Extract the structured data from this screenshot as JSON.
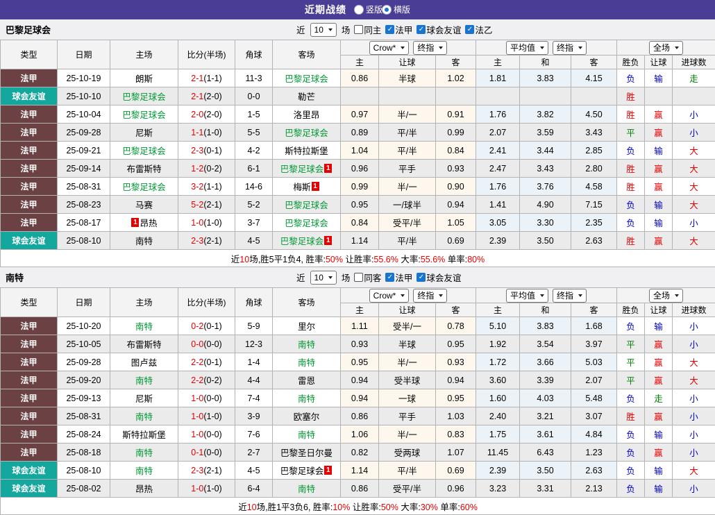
{
  "colors": {
    "titlebar_bg": "#4A3D96",
    "league": {
      "法甲": "#6B4143",
      "球会友谊": "#13A79E"
    },
    "focus_team_green": "#009933",
    "score_red": "#E60000",
    "checkbox_blue": "#1774D1",
    "even_row": "#EBEBEB",
    "crow_col_tint": "#FDF7EE",
    "avg_col_tint": "#ECF3F8",
    "result": {
      "胜": "#E60000",
      "赢": "#E60000",
      "大": "#E60000",
      "平": "#008000",
      "走": "#008000",
      "负": "#0000CC",
      "输": "#0000CC",
      "小": "#0000CC"
    }
  },
  "titlebar": {
    "title": "近期战绩",
    "radios": [
      {
        "label": "竖版",
        "checked": false
      },
      {
        "label": "横版",
        "checked": true
      }
    ]
  },
  "table_headers": {
    "main": [
      "类型",
      "日期",
      "主场",
      "比分(半场)",
      "角球",
      "客场"
    ],
    "selects": {
      "source": "Crow*",
      "source_ref": "终指",
      "avg": "平均值",
      "avg_ref": "终指",
      "scope": "全场"
    },
    "sub": [
      "主",
      "让球",
      "客",
      "主",
      "和",
      "客",
      "胜负",
      "让球",
      "进球数"
    ]
  },
  "sections": [
    {
      "team": "巴黎足球会",
      "filters": {
        "prefix": "近",
        "count": "10",
        "suffix": "场",
        "checks": [
          {
            "label": "同主",
            "checked": false
          },
          {
            "label": "法甲",
            "checked": true
          },
          {
            "label": "球会友谊",
            "checked": true
          },
          {
            "label": "法乙",
            "checked": true
          }
        ]
      },
      "rows": [
        {
          "league": "法甲",
          "date": "25-10-19",
          "home": {
            "name": "朗斯"
          },
          "score": "2-1",
          "half": "(1-1)",
          "corner": "11-3",
          "away": {
            "name": "巴黎足球会",
            "focus": true
          },
          "odds": [
            "0.86",
            "半球",
            "1.02",
            "1.81",
            "3.83",
            "4.15"
          ],
          "results": [
            "负",
            "输",
            "走"
          ]
        },
        {
          "league": "球会友谊",
          "date": "25-10-10",
          "home": {
            "name": "巴黎足球会",
            "focus": true
          },
          "score": "2-1",
          "half": "(2-0)",
          "corner": "0-0",
          "away": {
            "name": "勒芒"
          },
          "odds": [
            "",
            "",
            "",
            "",
            "",
            ""
          ],
          "results": [
            "胜",
            "",
            ""
          ]
        },
        {
          "league": "法甲",
          "date": "25-10-04",
          "home": {
            "name": "巴黎足球会",
            "focus": true
          },
          "score": "2-0",
          "half": "(2-0)",
          "corner": "1-5",
          "away": {
            "name": "洛里昂"
          },
          "odds": [
            "0.97",
            "半/一",
            "0.91",
            "1.76",
            "3.82",
            "4.50"
          ],
          "results": [
            "胜",
            "赢",
            "小"
          ]
        },
        {
          "league": "法甲",
          "date": "25-09-28",
          "home": {
            "name": "尼斯"
          },
          "score": "1-1",
          "half": "(1-0)",
          "corner": "5-5",
          "away": {
            "name": "巴黎足球会",
            "focus": true
          },
          "odds": [
            "0.89",
            "平/半",
            "0.99",
            "2.07",
            "3.59",
            "3.43"
          ],
          "results": [
            "平",
            "赢",
            "小"
          ]
        },
        {
          "league": "法甲",
          "date": "25-09-21",
          "home": {
            "name": "巴黎足球会",
            "focus": true
          },
          "score": "2-3",
          "half": "(0-1)",
          "corner": "4-2",
          "away": {
            "name": "斯特拉斯堡"
          },
          "odds": [
            "1.04",
            "平/半",
            "0.84",
            "2.41",
            "3.44",
            "2.85"
          ],
          "results": [
            "负",
            "输",
            "大"
          ]
        },
        {
          "league": "法甲",
          "date": "25-09-14",
          "home": {
            "name": "布雷斯特"
          },
          "score": "1-2",
          "half": "(0-2)",
          "corner": "6-1",
          "away": {
            "name": "巴黎足球会",
            "focus": true,
            "badge": "1",
            "badge_pos": "after"
          },
          "odds": [
            "0.96",
            "平手",
            "0.93",
            "2.47",
            "3.43",
            "2.80"
          ],
          "results": [
            "胜",
            "赢",
            "大"
          ]
        },
        {
          "league": "法甲",
          "date": "25-08-31",
          "home": {
            "name": "巴黎足球会",
            "focus": true
          },
          "score": "3-2",
          "half": "(1-1)",
          "corner": "14-6",
          "away": {
            "name": "梅斯",
            "badge": "1",
            "badge_pos": "after"
          },
          "odds": [
            "0.99",
            "半/一",
            "0.90",
            "1.76",
            "3.76",
            "4.58"
          ],
          "results": [
            "胜",
            "赢",
            "大"
          ]
        },
        {
          "league": "法甲",
          "date": "25-08-23",
          "home": {
            "name": "马赛"
          },
          "score": "5-2",
          "half": "(2-1)",
          "corner": "5-2",
          "away": {
            "name": "巴黎足球会",
            "focus": true
          },
          "odds": [
            "0.95",
            "一/球半",
            "0.94",
            "1.41",
            "4.90",
            "7.15"
          ],
          "results": [
            "负",
            "输",
            "大"
          ]
        },
        {
          "league": "法甲",
          "date": "25-08-17",
          "home": {
            "name": "昂热",
            "badge": "1",
            "badge_pos": "before"
          },
          "score": "1-0",
          "half": "(1-0)",
          "corner": "3-7",
          "away": {
            "name": "巴黎足球会",
            "focus": true
          },
          "odds": [
            "0.84",
            "受平/半",
            "1.05",
            "3.05",
            "3.30",
            "2.35"
          ],
          "results": [
            "负",
            "输",
            "小"
          ]
        },
        {
          "league": "球会友谊",
          "date": "25-08-10",
          "home": {
            "name": "南特"
          },
          "score": "2-3",
          "half": "(2-1)",
          "corner": "4-5",
          "away": {
            "name": "巴黎足球会",
            "focus": true,
            "badge": "1",
            "badge_pos": "after"
          },
          "odds": [
            "1.14",
            "平/半",
            "0.69",
            "2.39",
            "3.50",
            "2.63"
          ],
          "results": [
            "胜",
            "赢",
            "大"
          ]
        }
      ],
      "summary": [
        {
          "text": "近",
          "red": false
        },
        {
          "text": "10",
          "red": true
        },
        {
          "text": "场,胜5平1负4, 胜率:",
          "red": false
        },
        {
          "text": "50%",
          "red": true
        },
        {
          "text": " 让胜率:",
          "red": false
        },
        {
          "text": "55.6%",
          "red": true
        },
        {
          "text": " 大率:",
          "red": false
        },
        {
          "text": "55.6%",
          "red": true
        },
        {
          "text": " 单率:",
          "red": false
        },
        {
          "text": "80%",
          "red": true
        }
      ]
    },
    {
      "team": "南特",
      "filters": {
        "prefix": "近",
        "count": "10",
        "suffix": "场",
        "checks": [
          {
            "label": "同客",
            "checked": false
          },
          {
            "label": "法甲",
            "checked": true
          },
          {
            "label": "球会友谊",
            "checked": true
          }
        ]
      },
      "rows": [
        {
          "league": "法甲",
          "date": "25-10-20",
          "home": {
            "name": "南特",
            "focus": true
          },
          "score": "0-2",
          "half": "(0-1)",
          "corner": "5-9",
          "away": {
            "name": "里尔"
          },
          "odds": [
            "1.11",
            "受半/一",
            "0.78",
            "5.10",
            "3.83",
            "1.68"
          ],
          "results": [
            "负",
            "输",
            "小"
          ]
        },
        {
          "league": "法甲",
          "date": "25-10-05",
          "home": {
            "name": "布雷斯特"
          },
          "score": "0-0",
          "half": "(0-0)",
          "corner": "12-3",
          "away": {
            "name": "南特",
            "focus": true
          },
          "odds": [
            "0.93",
            "半球",
            "0.95",
            "1.92",
            "3.54",
            "3.97"
          ],
          "results": [
            "平",
            "赢",
            "小"
          ]
        },
        {
          "league": "法甲",
          "date": "25-09-28",
          "home": {
            "name": "图卢兹"
          },
          "score": "2-2",
          "half": "(0-1)",
          "corner": "1-4",
          "away": {
            "name": "南特",
            "focus": true
          },
          "odds": [
            "0.95",
            "半/一",
            "0.93",
            "1.72",
            "3.66",
            "5.03"
          ],
          "results": [
            "平",
            "赢",
            "大"
          ]
        },
        {
          "league": "法甲",
          "date": "25-09-20",
          "home": {
            "name": "南特",
            "focus": true
          },
          "score": "2-2",
          "half": "(0-2)",
          "corner": "4-4",
          "away": {
            "name": "雷恩"
          },
          "odds": [
            "0.94",
            "受半球",
            "0.94",
            "3.60",
            "3.39",
            "2.07"
          ],
          "results": [
            "平",
            "赢",
            "大"
          ]
        },
        {
          "league": "法甲",
          "date": "25-09-13",
          "home": {
            "name": "尼斯"
          },
          "score": "1-0",
          "half": "(0-0)",
          "corner": "7-4",
          "away": {
            "name": "南特",
            "focus": true
          },
          "odds": [
            "0.94",
            "一球",
            "0.95",
            "1.60",
            "4.03",
            "5.48"
          ],
          "results": [
            "负",
            "走",
            "小"
          ]
        },
        {
          "league": "法甲",
          "date": "25-08-31",
          "home": {
            "name": "南特",
            "focus": true
          },
          "score": "1-0",
          "half": "(1-0)",
          "corner": "3-9",
          "away": {
            "name": "欧塞尔"
          },
          "odds": [
            "0.86",
            "平手",
            "1.03",
            "2.40",
            "3.21",
            "3.07"
          ],
          "results": [
            "胜",
            "赢",
            "小"
          ]
        },
        {
          "league": "法甲",
          "date": "25-08-24",
          "home": {
            "name": "斯特拉斯堡"
          },
          "score": "1-0",
          "half": "(0-0)",
          "corner": "7-6",
          "away": {
            "name": "南特",
            "focus": true
          },
          "odds": [
            "1.06",
            "半/一",
            "0.83",
            "1.75",
            "3.61",
            "4.84"
          ],
          "results": [
            "负",
            "输",
            "小"
          ]
        },
        {
          "league": "法甲",
          "date": "25-08-18",
          "home": {
            "name": "南特",
            "focus": true
          },
          "score": "0-1",
          "half": "(0-0)",
          "corner": "2-7",
          "away": {
            "name": "巴黎圣日尔曼"
          },
          "odds": [
            "0.82",
            "受两球",
            "1.07",
            "11.45",
            "6.43",
            "1.23"
          ],
          "results": [
            "负",
            "赢",
            "小"
          ]
        },
        {
          "league": "球会友谊",
          "date": "25-08-10",
          "home": {
            "name": "南特",
            "focus": true
          },
          "score": "2-3",
          "half": "(2-1)",
          "corner": "4-5",
          "away": {
            "name": "巴黎足球会",
            "badge": "1",
            "badge_pos": "after"
          },
          "odds": [
            "1.14",
            "平/半",
            "0.69",
            "2.39",
            "3.50",
            "2.63"
          ],
          "results": [
            "负",
            "输",
            "大"
          ]
        },
        {
          "league": "球会友谊",
          "date": "25-08-02",
          "home": {
            "name": "昂热"
          },
          "score": "1-0",
          "half": "(1-0)",
          "corner": "6-4",
          "away": {
            "name": "南特",
            "focus": true
          },
          "odds": [
            "0.86",
            "受平/半",
            "0.96",
            "3.23",
            "3.31",
            "2.13"
          ],
          "results": [
            "负",
            "输",
            "小"
          ]
        }
      ],
      "summary": [
        {
          "text": "近",
          "red": false
        },
        {
          "text": "10",
          "red": true
        },
        {
          "text": "场,胜1平3负6, 胜率:",
          "red": false
        },
        {
          "text": "10%",
          "red": true
        },
        {
          "text": " 让胜率:",
          "red": false
        },
        {
          "text": "50%",
          "red": true
        },
        {
          "text": " 大率:",
          "red": false
        },
        {
          "text": "30%",
          "red": true
        },
        {
          "text": " 单率:",
          "red": false
        },
        {
          "text": "60%",
          "red": true
        }
      ]
    }
  ]
}
